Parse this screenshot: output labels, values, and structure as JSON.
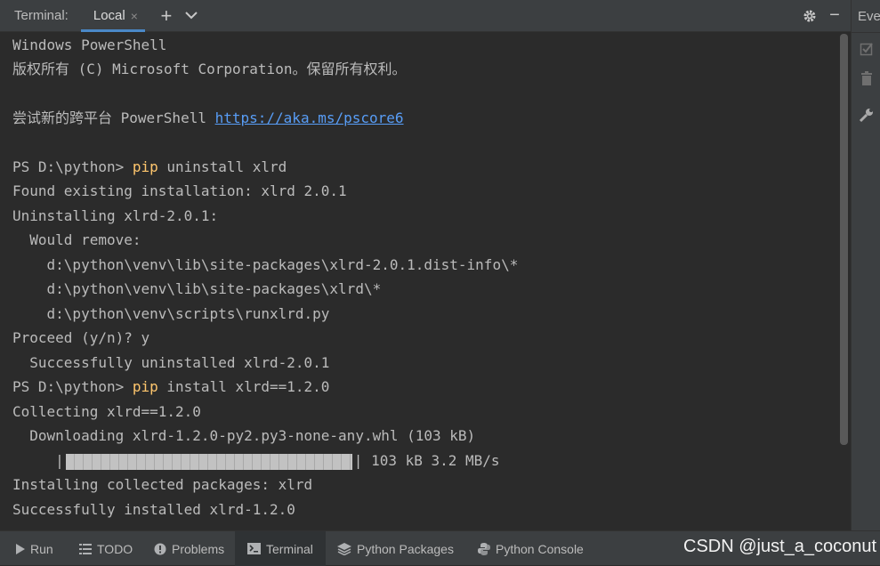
{
  "toolbar": {
    "title": "Terminal:",
    "tab_label": "Local",
    "tab_close": "×",
    "add_icon": "+",
    "dropdown_icon": "⌄",
    "settings_icon": "gear-icon",
    "minimize_icon": "−"
  },
  "right_panel": {
    "title": "Eve",
    "icons": [
      "check-icon",
      "trash-icon",
      "wrench-icon"
    ]
  },
  "terminal": {
    "lines": [
      "Windows PowerShell",
      "版权所有 (C) Microsoft Corporation。保留所有权利。",
      "",
      "尝试新的跨平台 PowerShell ",
      "",
      "PS D:\\python> ",
      "Found existing installation: xlrd 2.0.1",
      "Uninstalling xlrd-2.0.1:",
      "  Would remove:",
      "    d:\\python\\venv\\lib\\site-packages\\xlrd-2.0.1.dist-info\\*",
      "    d:\\python\\venv\\lib\\site-packages\\xlrd\\*",
      "    d:\\python\\venv\\scripts\\runxlrd.py",
      "Proceed (y/n)? y",
      "  Successfully uninstalled xlrd-2.0.1",
      "PS D:\\python> ",
      "Collecting xlrd==1.2.0",
      "  Downloading xlrd-1.2.0-py2.py3-none-any.whl (103 kB)",
      "     |",
      "Installing collected packages: xlrd",
      "Successfully installed xlrd-1.2.0"
    ],
    "link": "https://aka.ms/pscore6",
    "cmd1_keyword": "pip",
    "cmd1_rest": " uninstall xlrd",
    "cmd2_keyword": "pip",
    "cmd2_rest": " install xlrd==1.2.0",
    "progress_suffix": "| 103 kB 3.2 MB/s",
    "progress_fraction": 1.0
  },
  "bottom_tabs": [
    {
      "label": "Run",
      "icon": "run-icon"
    },
    {
      "label": "TODO",
      "icon": "list-icon"
    },
    {
      "label": "Problems",
      "icon": "problems-icon"
    },
    {
      "label": "Terminal",
      "icon": "terminal-icon",
      "active": true
    },
    {
      "label": "Python Packages",
      "icon": "layers-icon"
    },
    {
      "label": "Python Console",
      "icon": "python-icon"
    }
  ],
  "watermark": "CSDN @just_a_coconut",
  "colors": {
    "background": "#2b2b2b",
    "toolbar": "#3c3f41",
    "keyword": "#ffc66d",
    "link": "#589df6",
    "accent": "#4a88c7"
  }
}
